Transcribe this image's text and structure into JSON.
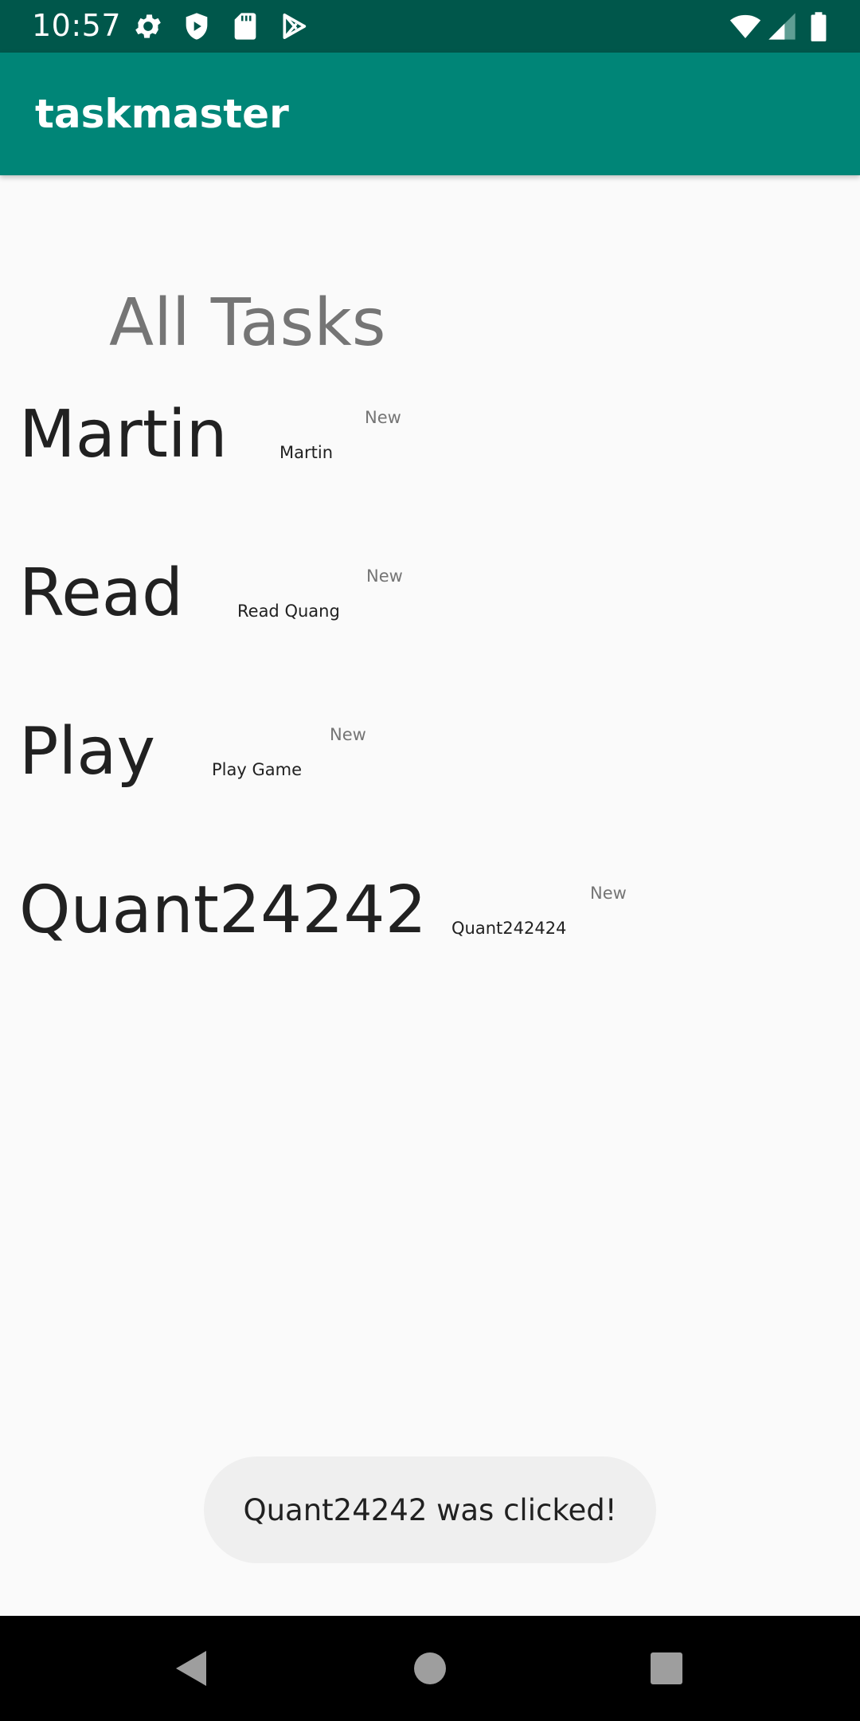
{
  "status_bar": {
    "time": "10:57",
    "left_icons": [
      "settings-icon",
      "shield-icon",
      "sd-card-icon",
      "play-store-icon"
    ],
    "right_icons": [
      "wifi-icon",
      "cell-signal-icon",
      "battery-icon"
    ],
    "background": "#00574b"
  },
  "app_bar": {
    "title": "taskmaster",
    "background": "#008577"
  },
  "main": {
    "heading": "All Tasks",
    "tasks": [
      {
        "title": "Martin",
        "body": "Martin",
        "state": "New"
      },
      {
        "title": "Read",
        "body": "Read Quang",
        "state": "New"
      },
      {
        "title": "Play",
        "body": "Play Game",
        "state": "New"
      },
      {
        "title": "Quant24242",
        "body": "Quant242424",
        "state": "New"
      }
    ]
  },
  "toast": {
    "text": "Quant24242 was clicked!"
  },
  "nav_bar": {
    "buttons": [
      "back-icon",
      "home-icon",
      "recents-icon"
    ]
  }
}
